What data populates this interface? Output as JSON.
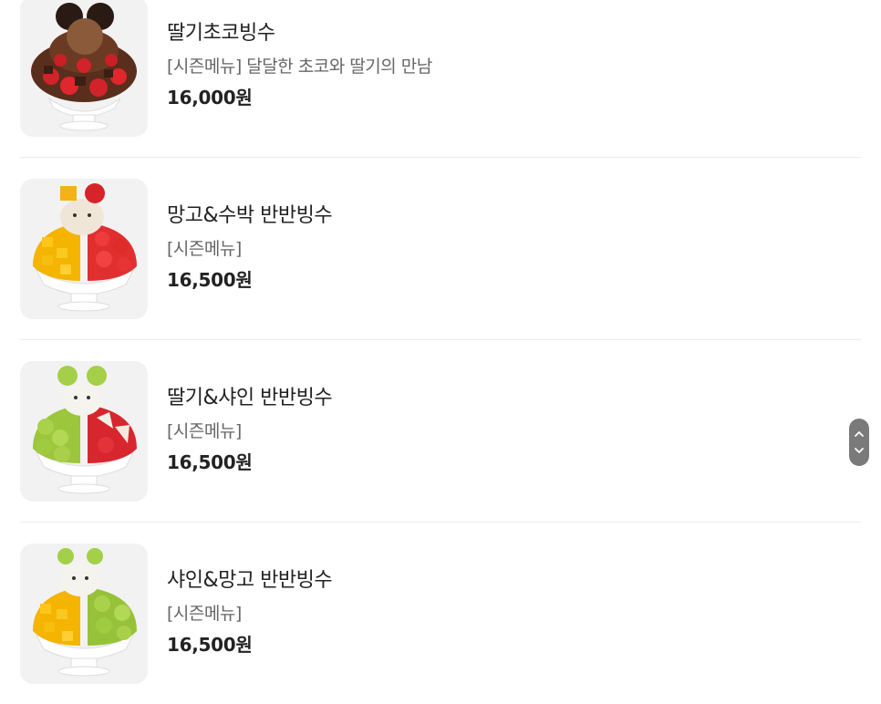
{
  "menu": {
    "items": [
      {
        "name": "딸기초코빙수",
        "description": "[시즌메뉴] 달달한 초코와 딸기의 만남",
        "price": "16,000원",
        "image_icon": "strawberry-choco-bingsu-icon"
      },
      {
        "name": "망고&수박 반반빙수",
        "description": "[시즌메뉴]",
        "price": "16,500원",
        "image_icon": "mango-watermelon-bingsu-icon"
      },
      {
        "name": "딸기&샤인 반반빙수",
        "description": "[시즌메뉴]",
        "price": "16,500원",
        "image_icon": "strawberry-shine-bingsu-icon"
      },
      {
        "name": "샤인&망고 반반빙수",
        "description": "[시즌메뉴]",
        "price": "16,500원",
        "image_icon": "shine-mango-bingsu-icon"
      }
    ]
  },
  "colors": {
    "text_primary": "#222222",
    "text_secondary": "#666666",
    "thumb_background": "#f2f2f2",
    "divider": "#ececec",
    "scroll_widget": "#7a7a7a"
  },
  "scroll_widget": {
    "up_icon": "chevron-up-icon",
    "down_icon": "chevron-down-icon"
  }
}
